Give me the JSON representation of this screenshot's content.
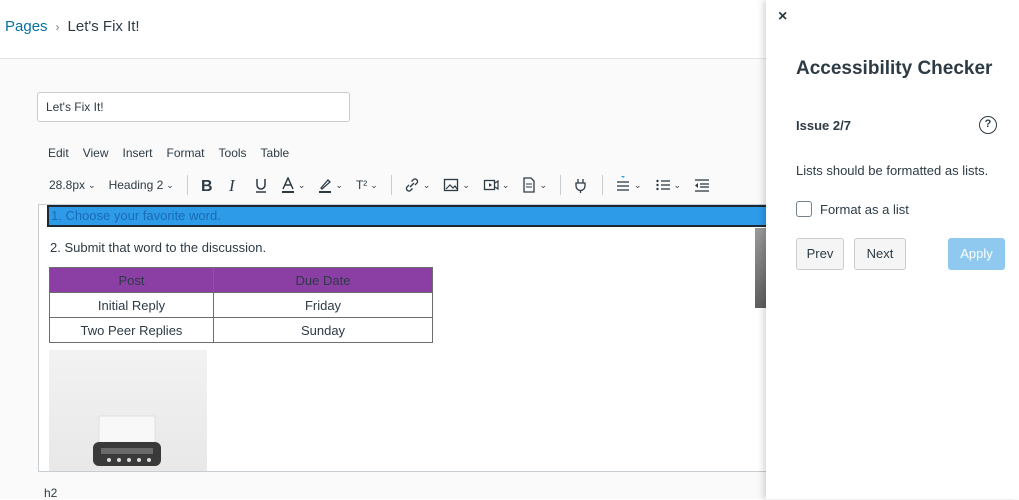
{
  "breadcrumb": {
    "root": "Pages",
    "separator": "›",
    "current": "Let's Fix It!"
  },
  "editor": {
    "title_value": "Let's Fix It!",
    "menu": [
      "Edit",
      "View",
      "Insert",
      "Format",
      "Tools",
      "Table"
    ],
    "toolbar": {
      "font_size": "28.8px",
      "block_format": "Heading 2",
      "superscript_label": "T²"
    },
    "content": {
      "highlighted_line": "1. Choose your favorite word.",
      "line2": "2. Submit that word to the discussion.",
      "table": {
        "headers": [
          "Post",
          "Due Date"
        ],
        "rows": [
          [
            "Initial Reply",
            "Friday"
          ],
          [
            "Two Peer Replies",
            "Sunday"
          ]
        ],
        "header_color": "#8b3ea3"
      }
    },
    "status_path": "h2",
    "highlight_color": "#2e9be8"
  },
  "panel": {
    "close_label": "×",
    "title": "Accessibility Checker",
    "issue_label": "Issue 2/7",
    "help_label": "?",
    "message": "Lists should be formatted as lists.",
    "checkbox_label": "Format as a list",
    "prev_label": "Prev",
    "next_label": "Next",
    "apply_label": "Apply",
    "apply_color": "#8fc9f0"
  }
}
